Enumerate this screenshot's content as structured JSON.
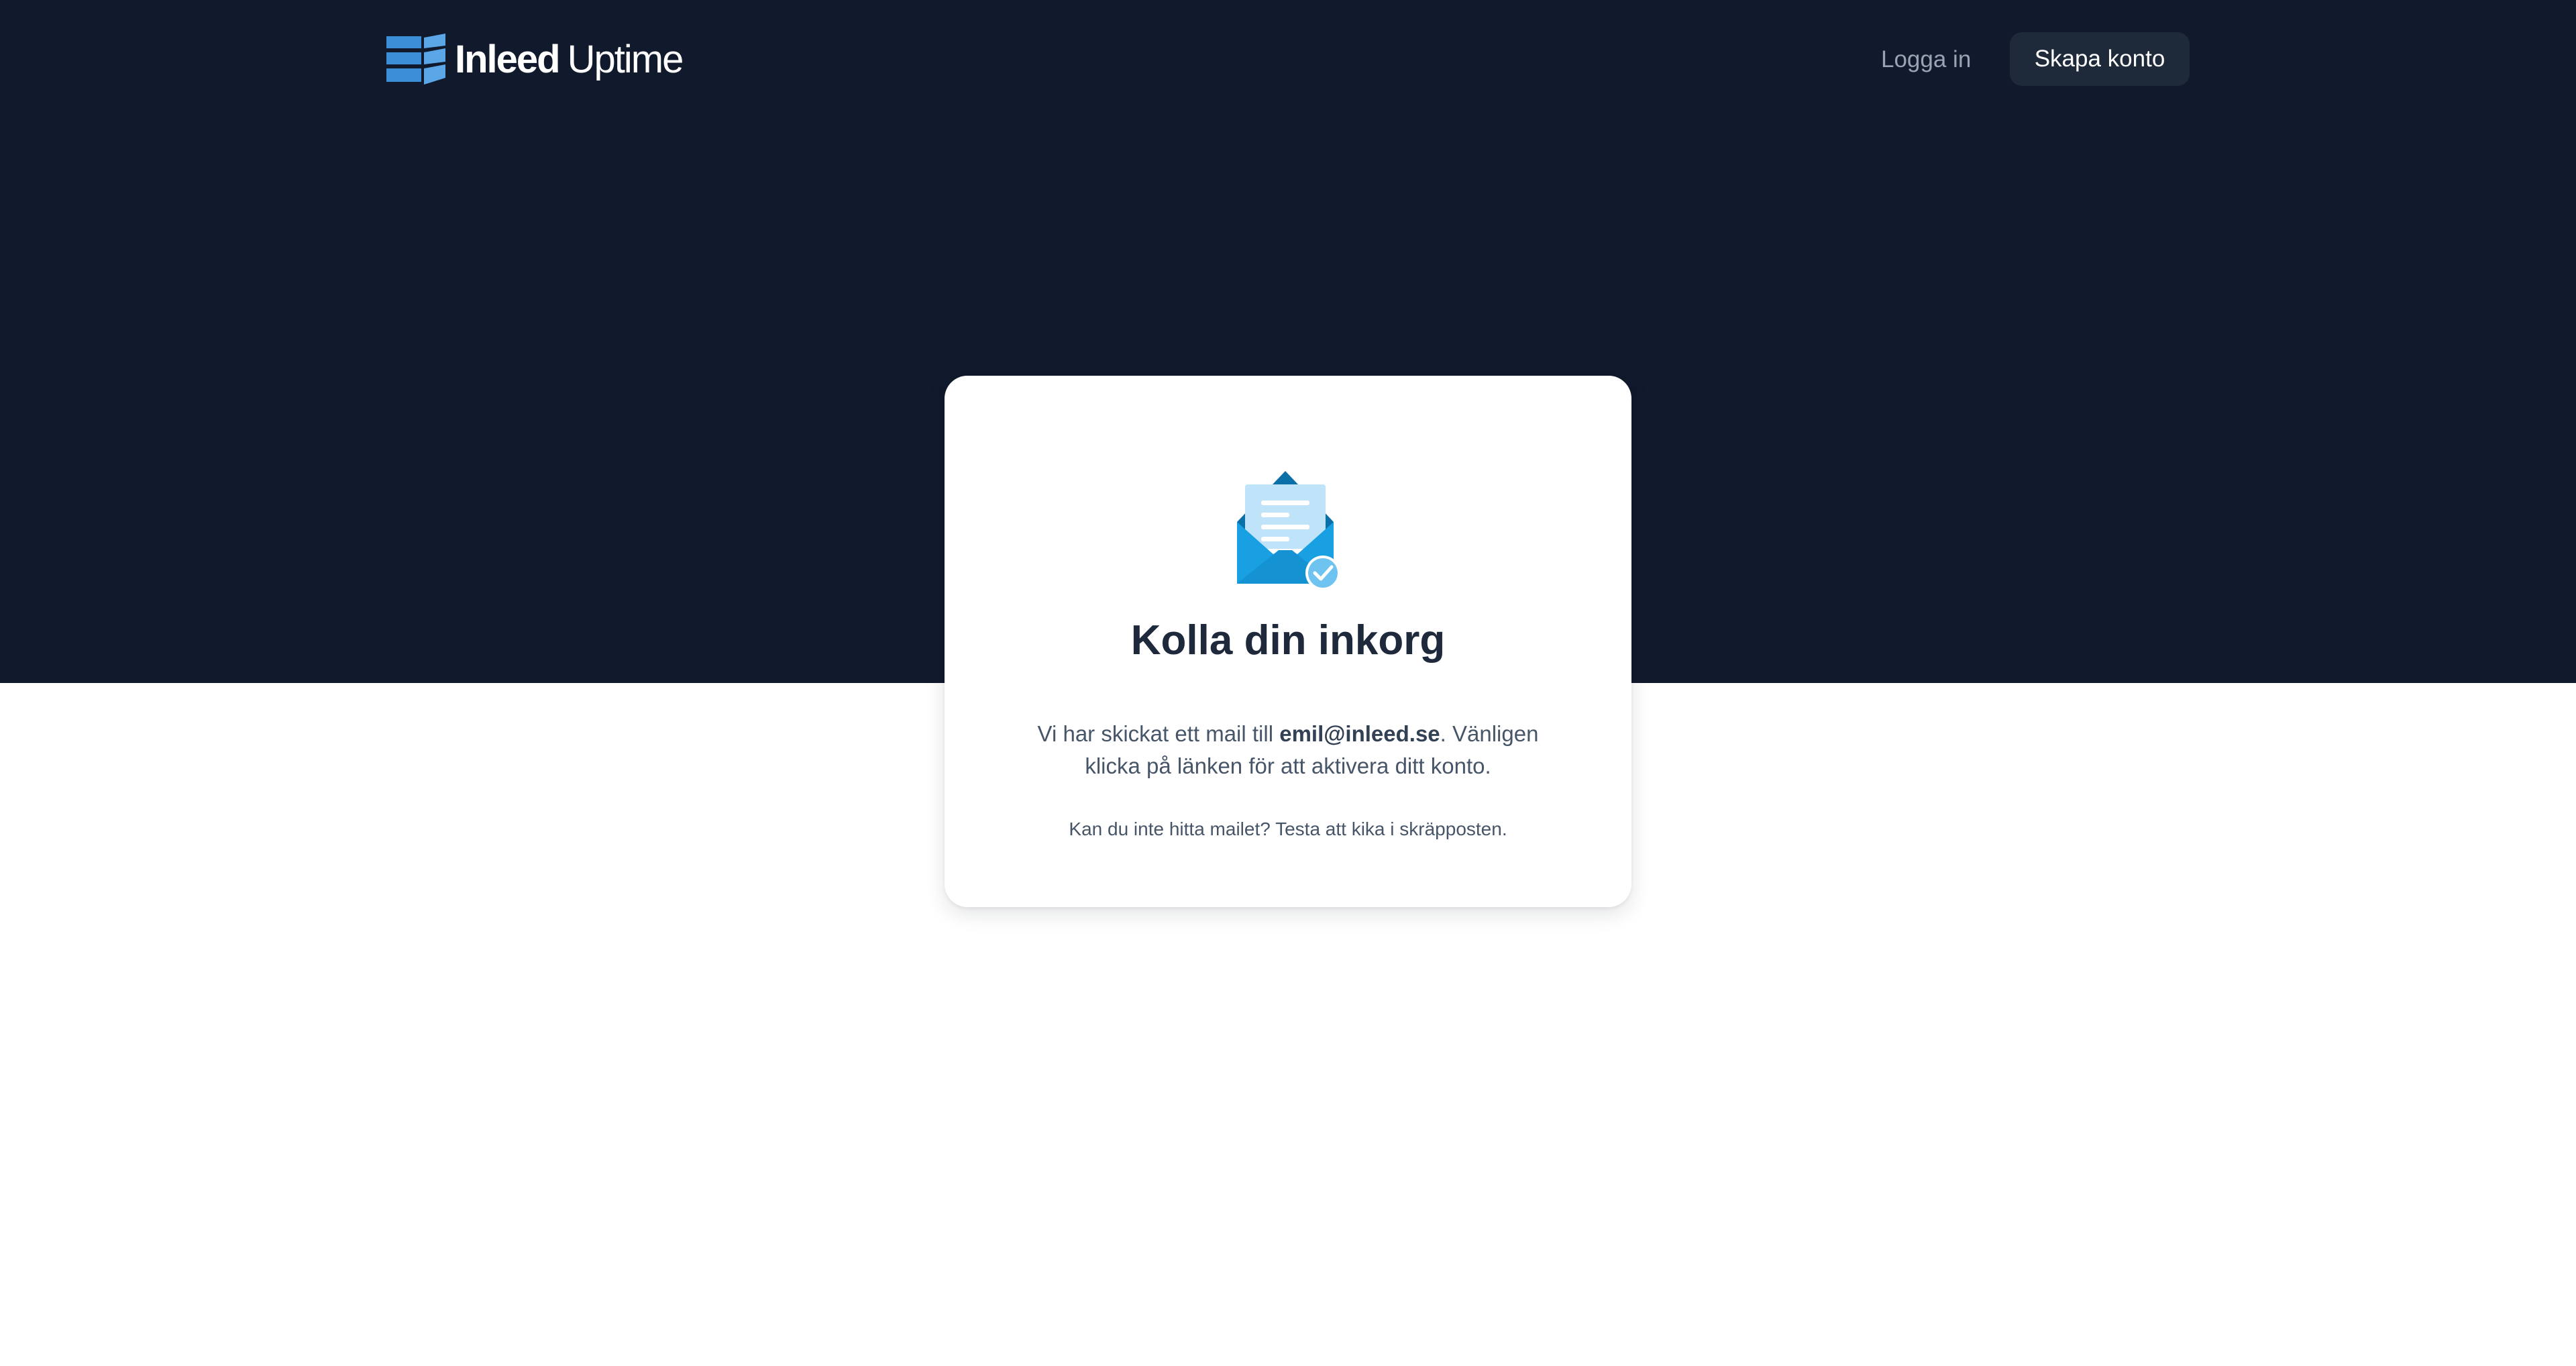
{
  "header": {
    "logo": {
      "brand": "Inleed",
      "product": "Uptime",
      "icon": "inleed-stacked-blocks-logo",
      "color": "#3b8fd8"
    },
    "login_label": "Logga in",
    "signup_label": "Skapa konto"
  },
  "card": {
    "illustration_icon": "open-envelope-checkmark-icon",
    "title": "Kolla din inkorg",
    "message_before": "Vi har skickat ett mail till ",
    "email": "emil@inleed.se",
    "message_after": ". Vänligen klicka på länken för att aktivera ditt konto.",
    "hint": "Kan du inte hitta mailet? Testa att kika i skräpposten."
  },
  "colors": {
    "hero_background": "#111a2c",
    "button_background": "#1e293a",
    "accent": "#1aa3e8"
  }
}
